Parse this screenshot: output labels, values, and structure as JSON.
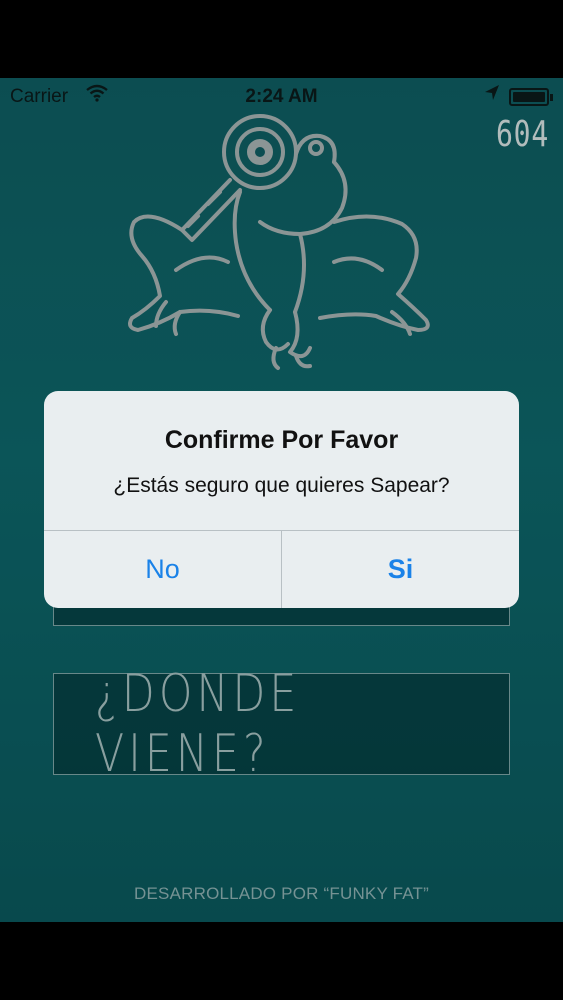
{
  "status_bar": {
    "carrier": "Carrier",
    "time": "2:24 AM",
    "icons": [
      "wifi-icon",
      "location-arrow-icon",
      "battery-icon"
    ]
  },
  "counter": "604",
  "logo": {
    "icon": "frog-magnifier-logo"
  },
  "main": {
    "donde_button_label": "¿DONDE VIENE?"
  },
  "footer": "DESARROLLADO POR “FUNKY FAT”",
  "alert": {
    "title": "Confirme Por Favor",
    "message": "¿Estás seguro que quieres Sapear?",
    "no_label": "No",
    "si_label": "Si"
  },
  "colors": {
    "background": "#0e686c",
    "alert_background": "#e9eef0",
    "alert_button": "#1a82e8",
    "logo_stroke": "#aab6b6"
  }
}
